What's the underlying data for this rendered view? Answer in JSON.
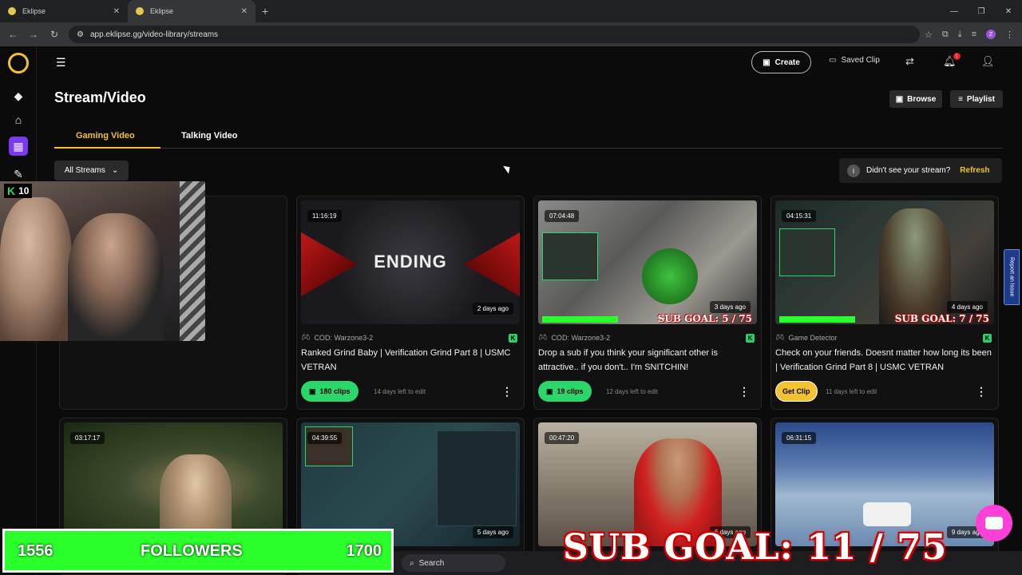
{
  "browser": {
    "tabs": [
      {
        "title": "Eklipse"
      },
      {
        "title": "Eklipse"
      }
    ],
    "url": "app.eklipse.gg/video-library/streams",
    "profile_initial": "Z"
  },
  "topbar": {
    "create_label": "Create",
    "saved_clip_label": "Saved Clip",
    "notification_count": "1"
  },
  "page": {
    "title": "Stream/Video",
    "browse_label": "Browse",
    "playlist_label": "Playlist",
    "tabs": [
      {
        "label": "Gaming Video",
        "active": true
      },
      {
        "label": "Talking Video",
        "active": false
      }
    ],
    "filter_label": "All Streams",
    "notice_text": "Didn't see your stream?",
    "refresh_label": "Refresh"
  },
  "cards": [
    {
      "duration": "11:16:19",
      "ago": "2 days ago",
      "game": "COD: Warzone3-2",
      "title": "Ranked Grind Baby | Verification Grind Part 8 | USMC VETRAN",
      "clips": "180 clips",
      "days_left": "14 days left to edit",
      "thumb_text": "ENDING"
    },
    {
      "duration": "07:04:48",
      "ago": "3 days ago",
      "game": "COD: Warzone3-2",
      "title": "Drop a sub if you think your significant other is attractive.. if you don't.. I'm SNITCHIN!",
      "clips": "19 clips",
      "days_left": "12 days left to edit",
      "thumb_text": "SUB GOAL: 5 / 75"
    },
    {
      "duration": "04:15:31",
      "ago": "4 days ago",
      "game": "Game Detector",
      "title": "Check on your friends. Doesnt matter how long its been | Verification Grind Part 8 | USMC VETRAN",
      "clips": "Get Clip",
      "days_left": "11 days left to edit",
      "thumb_text": "SUB GOAL: 7 / 75"
    },
    {
      "duration": "03:17:17",
      "ago": ""
    },
    {
      "duration": "04:39:55",
      "ago": "5 days ago"
    },
    {
      "duration": "00:47:20",
      "ago": "6 days ago"
    },
    {
      "duration": "06:31:15",
      "ago": "9 days ago"
    }
  ],
  "overlay": {
    "kick_count": "10",
    "followers_current": "1556",
    "followers_label": "FOLLOWERS",
    "followers_goal": "1700",
    "sub_goal": "SUB GOAL: 11 / 75",
    "taskbar_search": "Search",
    "report_label": "Report an Issue"
  },
  "colors": {
    "accent": "#f2c230",
    "sidebar_active": "#7c3aed",
    "clips_green": "#2bd66b"
  }
}
